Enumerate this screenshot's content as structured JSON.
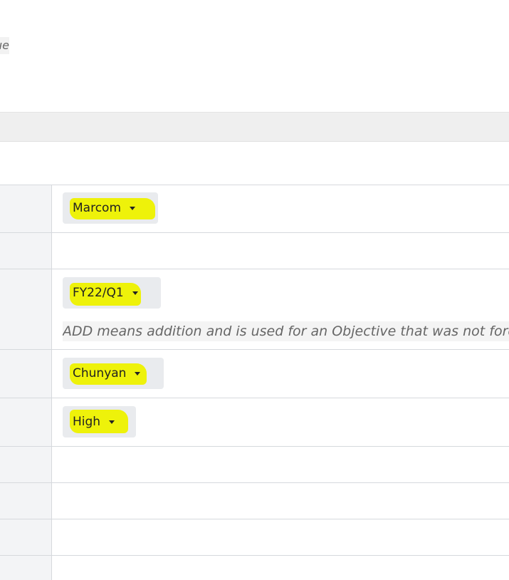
{
  "top_note": {
    "fragment": "ue"
  },
  "fields": {
    "team": {
      "value": "Marcom"
    },
    "period": {
      "value": "FY22/Q1",
      "hint": "ADD means addition and is used for an Objective that was not foresee"
    },
    "owner": {
      "value": "Chunyan"
    },
    "priority": {
      "value": "High"
    }
  },
  "highlight_color": "#eef20a",
  "icons": {
    "dropdown": "caret-down-icon"
  }
}
